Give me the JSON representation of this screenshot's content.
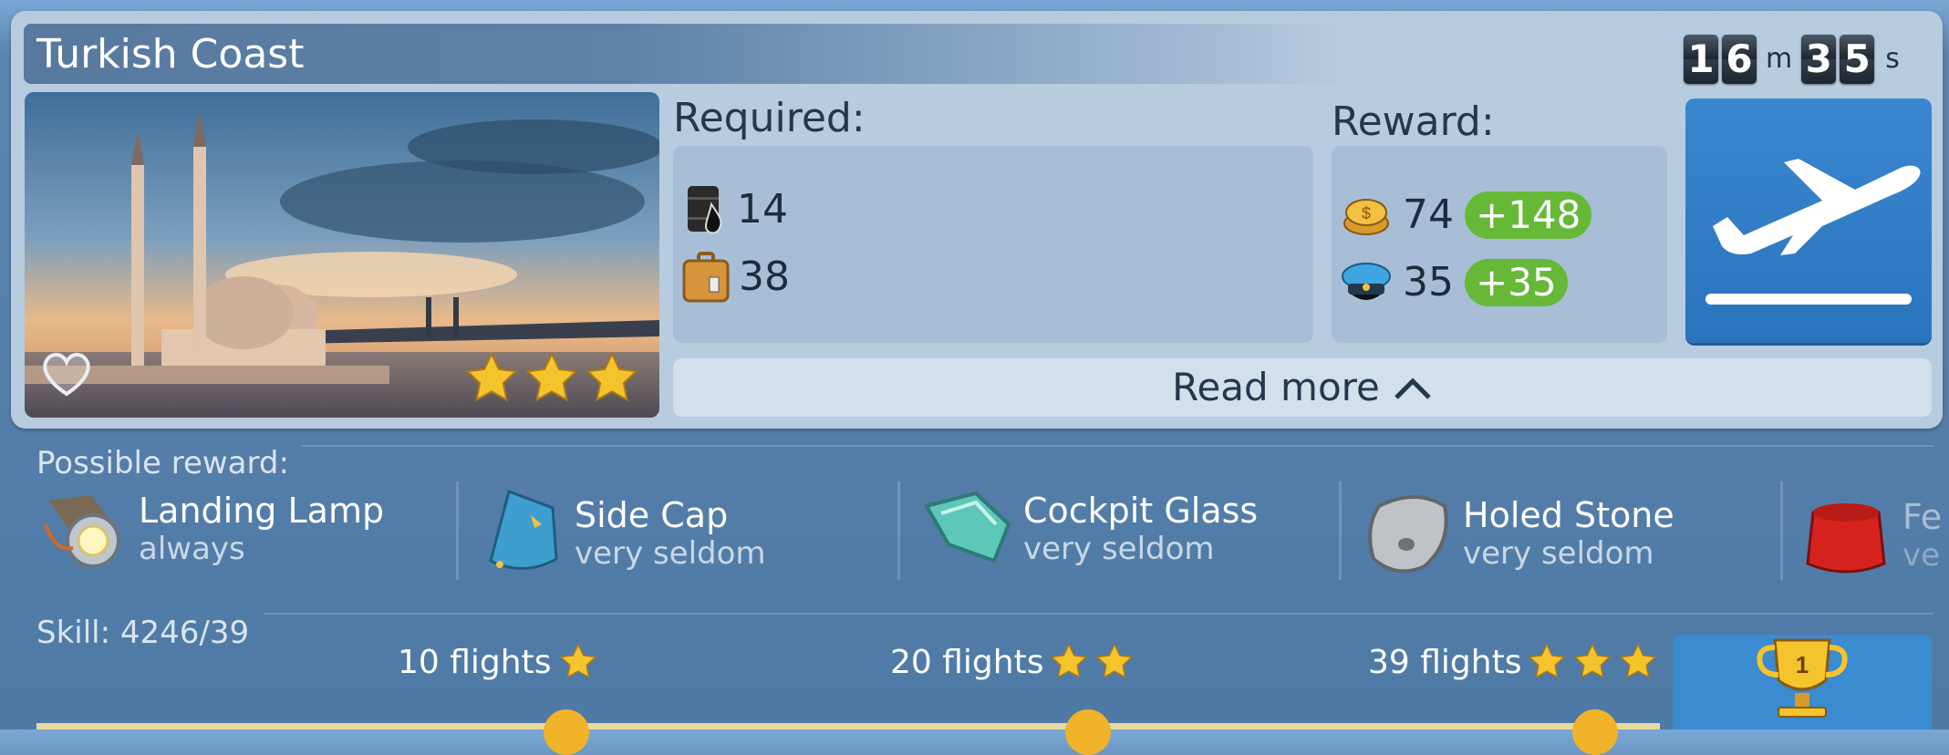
{
  "mission": {
    "title": "Turkish Coast",
    "timer": {
      "minutes_digits": [
        "1",
        "6"
      ],
      "minutes_unit": "m",
      "seconds_digits": [
        "3",
        "5"
      ],
      "seconds_unit": "s"
    },
    "stars": 3
  },
  "required": {
    "label": "Required:",
    "items": [
      {
        "icon": "oil-barrel-icon",
        "value": "14"
      },
      {
        "icon": "luggage-icon",
        "value": "38"
      }
    ]
  },
  "reward": {
    "label": "Reward:",
    "items": [
      {
        "icon": "coins-icon",
        "value": "74",
        "bonus": "+148"
      },
      {
        "icon": "pilot-cap-icon",
        "value": "35",
        "bonus": "+35"
      }
    ]
  },
  "read_more": {
    "label": "Read more"
  },
  "possible_reward": {
    "label": "Possible reward:",
    "items": [
      {
        "name": "Landing Lamp",
        "rarity": "always",
        "icon": "landing-lamp-icon"
      },
      {
        "name": "Side Cap",
        "rarity": "very seldom",
        "icon": "side-cap-icon"
      },
      {
        "name": "Cockpit Glass",
        "rarity": "very seldom",
        "icon": "cockpit-glass-icon"
      },
      {
        "name": "Holed Stone",
        "rarity": "very seldom",
        "icon": "holed-stone-icon"
      },
      {
        "name": "Fe",
        "rarity": "ve",
        "icon": "fez-icon"
      }
    ]
  },
  "skill": {
    "label": "Skill: 4246/39",
    "milestones": [
      {
        "label": "10 flights",
        "stars": 1
      },
      {
        "label": "20 flights",
        "stars": 2
      },
      {
        "label": "39 flights",
        "stars": 3
      }
    ],
    "trophy_rank": "1"
  },
  "colors": {
    "accent_blue": "#2a74bd",
    "bonus_green": "#66b936",
    "panel": "#b8cce0"
  }
}
